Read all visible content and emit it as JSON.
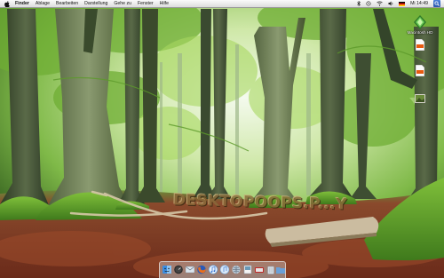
{
  "menubar": {
    "apple_icon": "apple-logo-icon",
    "app_name": "Finder",
    "menus": [
      "Ablage",
      "Bearbeiten",
      "Darstellung",
      "Gehe zu",
      "Fenster",
      "Hilfe"
    ],
    "status_icons": [
      "bluetooth-icon",
      "time-machine-icon",
      "wifi-icon",
      "volume-icon",
      "flag-icon"
    ],
    "clock": "Mi 14:49",
    "spotlight_icon": "spotlight-search-icon"
  },
  "desktop": {
    "icons": [
      {
        "label": "Macintosh HD",
        "icon": "hard-drive-icon"
      },
      {
        "label": "",
        "icon": "document-icon"
      },
      {
        "label": "",
        "icon": "document-icon"
      },
      {
        "label": "",
        "icon": "image-file-icon"
      }
    ],
    "wallpaper_text": "DESKTOPOOPS.P...Y",
    "wallpaper_description": "beech forest"
  },
  "dock": {
    "apps": [
      {
        "name": "finder",
        "icon": "finder-icon",
        "color": "#3c8de0"
      },
      {
        "name": "dashboard",
        "icon": "dashboard-icon",
        "color": "#333333"
      },
      {
        "name": "mail",
        "icon": "mail-icon",
        "color": "#b7c6d6"
      },
      {
        "name": "firefox",
        "icon": "firefox-icon",
        "color": "#e8701e"
      },
      {
        "name": "itunes",
        "icon": "itunes-icon",
        "color": "#5aa0e6"
      },
      {
        "name": "itunes",
        "icon": "itunes-icon",
        "color": "#7fb3e8"
      },
      {
        "name": "network-utility",
        "icon": "network-icon",
        "color": "#8aa0b0"
      },
      {
        "name": "preview",
        "icon": "preview-icon",
        "color": "#9ab"
      },
      {
        "name": "photo-booth",
        "icon": "photo-booth-icon",
        "color": "#c02828"
      },
      {
        "name": "trash",
        "icon": "trash-icon",
        "color": "#c0c8d0"
      },
      {
        "name": "folder",
        "icon": "folder-icon",
        "color": "#6aa0d8"
      }
    ]
  },
  "colors": {
    "menubar_bg": "#efefef",
    "foliage": "#8bc34a",
    "forest_floor": "#7a3a26"
  }
}
